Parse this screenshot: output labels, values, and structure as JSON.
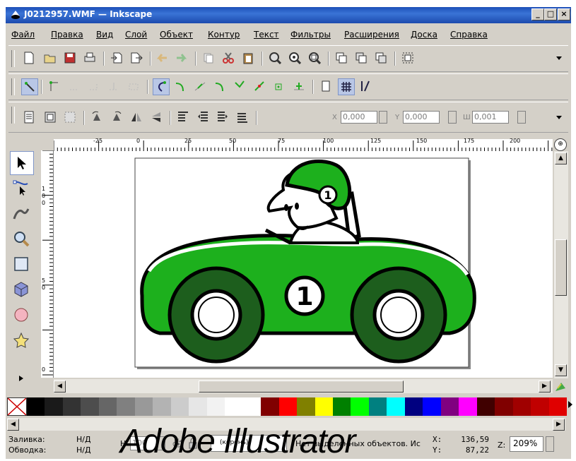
{
  "window": {
    "title": "J0212957.WMF — Inkscape",
    "minimize": "_",
    "maximize": "□",
    "close": "×"
  },
  "menu": [
    "Файл",
    "Правка",
    "Вид",
    "Слой",
    "Объект",
    "Контур",
    "Текст",
    "Фильтры",
    "Расширения",
    "Доска",
    "Справка"
  ],
  "toolbar_main": [
    "new-icon",
    "open-icon",
    "save-icon",
    "print-icon",
    "import-icon",
    "export-icon",
    "undo-icon",
    "redo-icon",
    "copy-icon",
    "cut-icon",
    "paste-icon",
    "zoom-selection-icon",
    "zoom-drawing-icon",
    "zoom-page-icon",
    "duplicate-icon",
    "clone-icon",
    "unlink-clone-icon",
    "group-icon"
  ],
  "snap_toolbar": [
    "snap-toggle-icon",
    "snap-bbox-icon",
    "snap-edge-icon",
    "snap-corner-icon",
    "snap-midpoint-icon",
    "snap-node-icon",
    "snap-path-icon",
    "snap-path-intersection-icon",
    "snap-smooth-icon",
    "snap-cusp-icon",
    "snap-center-icon",
    "snap-object-center-icon",
    "snap-page-border-icon",
    "snap-grid-icon",
    "snap-guide-icon"
  ],
  "selector_controls": {
    "x_label": "X",
    "x_value": "0,000",
    "y_label": "Y",
    "y_value": "0,000",
    "w_label": "Ш",
    "w_value": "0,001"
  },
  "ruler": {
    "h_labels": [
      "-25",
      "0",
      "25",
      "50",
      "75",
      "100",
      "125",
      "150",
      "175",
      "200"
    ],
    "v_labels": [
      "1",
      "0",
      "0",
      "5",
      "0",
      "0"
    ]
  },
  "canvas": {
    "badge_number": "1",
    "door_number": "1"
  },
  "palette": [
    "#000000",
    "#1a1a1a",
    "#333333",
    "#4d4d4d",
    "#666666",
    "#808080",
    "#999999",
    "#b3b3b3",
    "#cccccc",
    "#e6e6e6",
    "#f2f2f2",
    "#ffffff",
    "#ffffff",
    "#800000",
    "#ff0000",
    "#808000",
    "#ffff00",
    "#008000",
    "#00ff00",
    "#008080",
    "#00ffff",
    "#000080",
    "#0000ff",
    "#800080",
    "#ff00ff",
    "#400000",
    "#800000",
    "#a00000",
    "#c00000",
    "#e00000"
  ],
  "status": {
    "fill_label": "Заливка:",
    "fill_value": "Н/Д",
    "stroke_label": "Обводка:",
    "stroke_value": "Н/Д",
    "opacity_label": "Н",
    "opacity_value": "100",
    "layer": "(корень)",
    "message": "Нет выделенных объектов. Ис",
    "x_label": "X:",
    "x_value": "136,59",
    "y_label": "Y:",
    "y_value": "87,22",
    "zoom_label": "Z:",
    "zoom_value": "209%"
  },
  "watermark": "Adobe Illustrator"
}
